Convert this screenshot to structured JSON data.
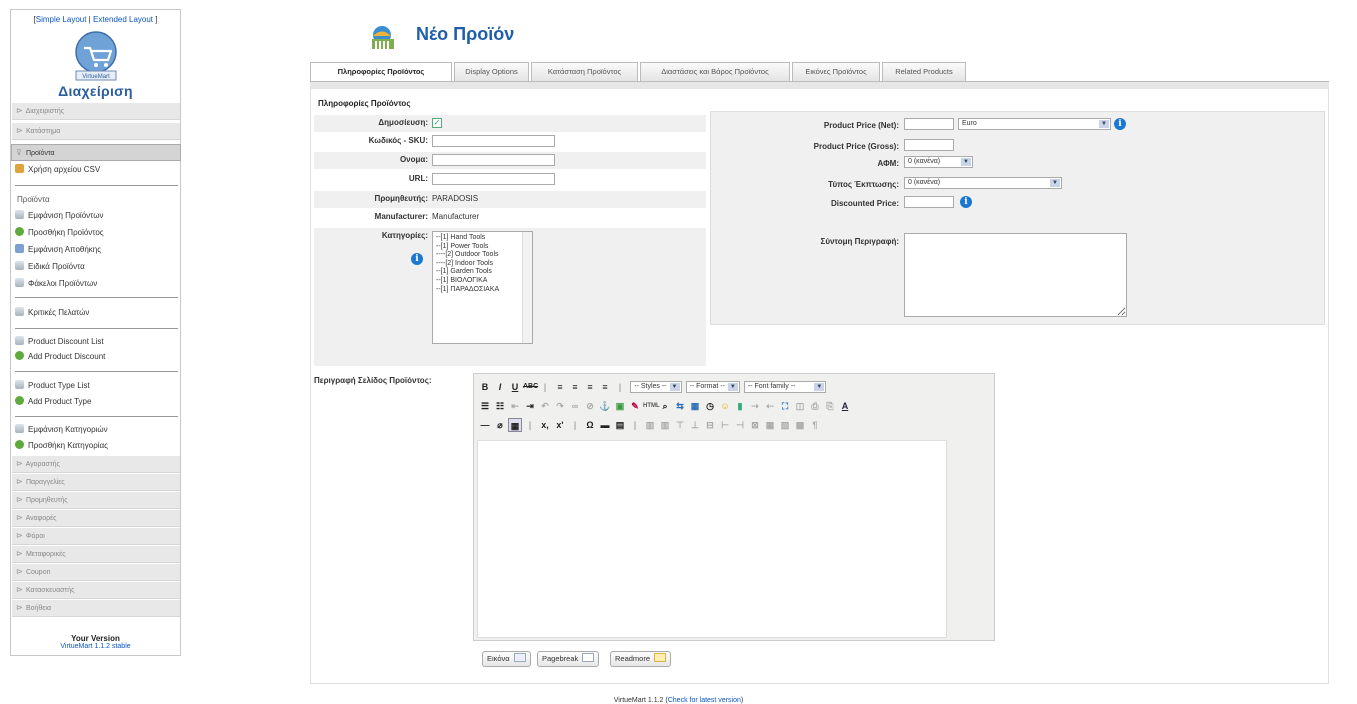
{
  "sidebar": {
    "layout_links": {
      "open": "[",
      "simple": "Simple Layout",
      "sep": " | ",
      "extended": "Extended Layout",
      "close": " ]"
    },
    "logo_label": "VirtueMart",
    "admin_title": "Διαχείριση",
    "sections_top": [
      {
        "label": "Διαχειριστής",
        "active": false
      },
      {
        "label": "Κατάστημα",
        "active": false
      },
      {
        "label": "Προϊόντα",
        "active": true
      }
    ],
    "csv_item": "Χρήση αρχείου CSV",
    "products_header": "Προϊόντα",
    "product_items": [
      {
        "label": "Εμφάνιση Προϊόντων",
        "icon": "document-icon"
      },
      {
        "label": "Προσθήκη Προϊόντος",
        "icon": "add-icon"
      },
      {
        "label": "Εμφάνιση Αποθήκης",
        "icon": "warehouse-icon"
      },
      {
        "label": "Ειδικά Προϊόντα",
        "icon": "document-icon"
      },
      {
        "label": "Φάκελοι Προϊόντων",
        "icon": "document-icon"
      }
    ],
    "reviews_item": "Κριτικές Πελατών",
    "discount_items": [
      {
        "label": "Product Discount List",
        "icon": "document-icon"
      },
      {
        "label": "Add Product Discount",
        "icon": "add-icon"
      }
    ],
    "type_items": [
      {
        "label": "Product Type List",
        "icon": "document-icon"
      },
      {
        "label": "Add Product Type",
        "icon": "add-icon"
      }
    ],
    "category_items": [
      {
        "label": "Εμφάνιση Κατηγοριών",
        "icon": "document-icon"
      },
      {
        "label": "Προσθήκη Κατηγορίας",
        "icon": "add-icon"
      }
    ],
    "sections_bottom": [
      "Αγοραστής",
      "Παραγγελίες",
      "Προμηθευτής",
      "Αναφορές",
      "Φόροι",
      "Μεταφορικές",
      "Coupon",
      "Κατασκευαστής",
      "Βοήθεια"
    ],
    "version_title": "Your Version",
    "version_number": "VirtueMart 1.1.2 stable"
  },
  "page": {
    "title": "Νέο Προϊόν"
  },
  "tabs": [
    {
      "label": "Πληροφορίες Προϊόντος",
      "active": true
    },
    {
      "label": "Display Options",
      "active": false
    },
    {
      "label": "Κατάσταση Προϊόντος",
      "active": false
    },
    {
      "label": "Διαστάσεις και Βάρος Προϊόντος",
      "active": false
    },
    {
      "label": "Εικόνες Προϊόντος",
      "active": false
    },
    {
      "label": "Related Products",
      "active": false
    }
  ],
  "form": {
    "section_title": "Πληροφορίες Προϊόντος",
    "publish_label": "Δημοσίευση:",
    "publish_checked": true,
    "sku_label": "Κωδικός - SKU:",
    "sku_value": "",
    "name_label": "Ονομα:",
    "name_value": "",
    "url_label": "URL:",
    "url_value": "",
    "vendor_label": "Προμηθευτής:",
    "vendor_value": "PARADOSIS",
    "manufacturer_label": "Manufacturer:",
    "manufacturer_value": "Manufacturer",
    "categories_label": "Κατηγορίες:",
    "categories": [
      "--[1] Hand Tools",
      "--[1] Power Tools",
      "----[2] Outdoor Tools",
      "----[2] Indoor Tools",
      "--[1] Garden Tools",
      "--[1] ΒΙΟΛΟΓΙΚΑ",
      "--[1] ΠΑΡΑΔΟΣΙΑΚΑ"
    ]
  },
  "price": {
    "net_label": "Product Price (Net):",
    "net_value": "",
    "currency": "Euro",
    "gross_label": "Product Price (Gross):",
    "gross_value": "",
    "vat_label": "ΑΦΜ:",
    "vat_value": "0 (κανένα)",
    "discount_type_label": "Τύπος Έκπτωσης:",
    "discount_type_value": "0 (κανένα)",
    "discounted_label": "Discounted Price:",
    "discounted_value": "",
    "short_desc_label": "Σύντομη Περιγραφή:"
  },
  "editor": {
    "label": "Περιγραφή Σελίδος Προϊόντος:",
    "styles": "-- Styles --",
    "format": "-- Format --",
    "font_family": "-- Font family --",
    "buttons": {
      "image": "Εικόνα",
      "pagebreak": "Pagebreak",
      "readmore": "Readmore"
    }
  },
  "footer": {
    "version": "VirtueMart 1.1.2",
    "open": " (",
    "check_link": "Check for latest version",
    "close": ")"
  }
}
